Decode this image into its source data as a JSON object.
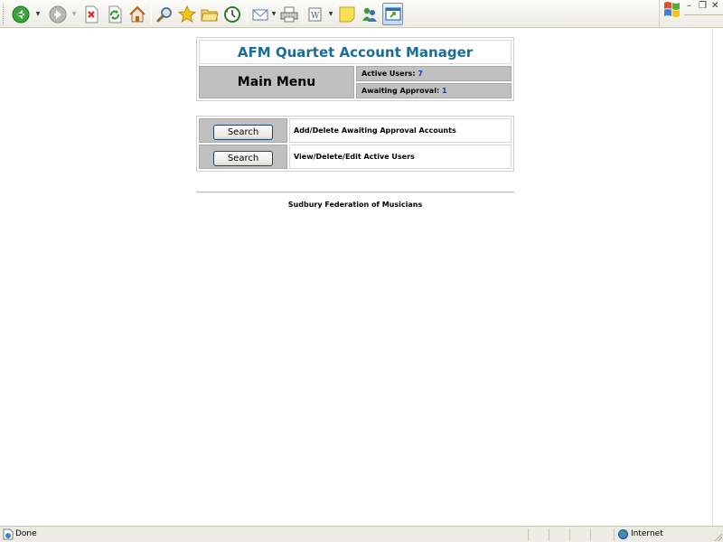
{
  "toolbar": {
    "buttons": [
      {
        "name": "back-icon",
        "color": "#2e9a2e"
      },
      {
        "name": "forward-icon",
        "color": "#9a9a9a"
      },
      {
        "name": "stop-icon",
        "color": "#d33"
      },
      {
        "name": "refresh-icon",
        "color": "#2e9a2e"
      },
      {
        "name": "home-icon",
        "color": "#d77a2a"
      },
      {
        "name": "search-icon",
        "color": "#5a7ba8"
      },
      {
        "name": "favorites-icon",
        "color": "#f2b90f"
      },
      {
        "name": "folder-icon",
        "color": "#e8c24a"
      },
      {
        "name": "history-icon",
        "color": "#2e9a2e"
      },
      {
        "name": "mail-icon",
        "color": "#4d78b8"
      },
      {
        "name": "print-icon",
        "color": "#7a7a7a"
      },
      {
        "name": "edit-icon",
        "color": "#6a6a6a"
      },
      {
        "name": "note-icon",
        "color": "#f3d44c"
      },
      {
        "name": "messenger-icon",
        "color": "#2f8f3d"
      },
      {
        "name": "window-icon",
        "color": "#2b6fb3"
      }
    ]
  },
  "page": {
    "title": "AFM Quartet Account Manager",
    "main_menu": "Main Menu",
    "stats": {
      "active_label": "Active Users:",
      "active_count": "7",
      "awaiting_label": "Awaiting Approval:",
      "awaiting_count": "1"
    },
    "actions": [
      {
        "button": "Search",
        "description": "Add/Delete Awaiting Approval Accounts"
      },
      {
        "button": "Search",
        "description": "View/Delete/Edit Active Users"
      }
    ],
    "footer": "Sudbury Federation of Musicians"
  },
  "statusbar": {
    "status": "Done",
    "zone": "Internet"
  },
  "colors": {
    "title": "#1b6d95",
    "cell_gray": "#c0c0c0",
    "count_blue": "#1a3fb5"
  }
}
